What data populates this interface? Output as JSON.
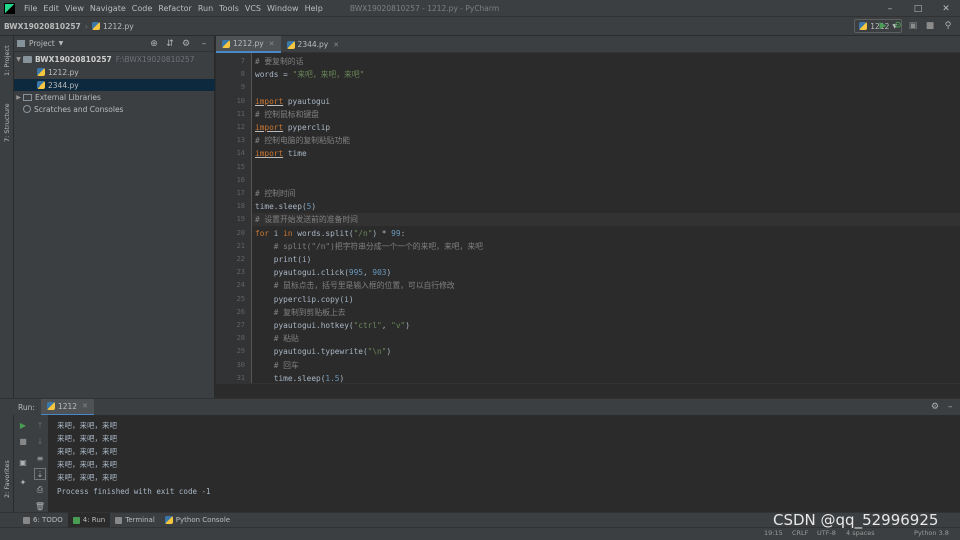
{
  "menu": {
    "items": [
      "File",
      "Edit",
      "View",
      "Navigate",
      "Code",
      "Refactor",
      "Run",
      "Tools",
      "VCS",
      "Window",
      "Help"
    ],
    "window_title": "BWX19020810257 - 1212.py - PyCharm"
  },
  "navbar": {
    "project": "BWX19020810257",
    "file": "1212.py",
    "run_config": "1212"
  },
  "project_panel": {
    "title": "Project",
    "root_name": "BWX19020810257",
    "root_path": "F:\\BWX19020810257",
    "files": [
      "1212.py",
      "2344.py"
    ],
    "external_libraries": "External Libraries",
    "scratches": "Scratches and Consoles"
  },
  "left_stripe": {
    "project_label": "1: Project",
    "structure_label": "7: Structure",
    "favorites_label": "2: Favorites"
  },
  "editor": {
    "tabs": [
      "1212.py",
      "2344.py"
    ],
    "line_numbers": [
      "7",
      "8",
      "9",
      "10",
      "11",
      "12",
      "13",
      "14",
      "15",
      "16",
      "17",
      "18",
      "19",
      "20",
      "21",
      "22",
      "23",
      "24",
      "25",
      "26",
      "27",
      "28",
      "29",
      "30",
      "31"
    ],
    "lines": [
      {
        "parts": [
          {
            "t": "# 要复制的话",
            "c": "cm"
          }
        ]
      },
      {
        "parts": [
          {
            "t": "words = ",
            "c": ""
          },
          {
            "t": "\"来吧，来吧，来吧\"",
            "c": "str"
          }
        ]
      },
      {
        "parts": []
      },
      {
        "parts": [
          {
            "t": "import",
            "c": "kw und"
          },
          {
            "t": " pyautogui",
            "c": ""
          }
        ]
      },
      {
        "parts": [
          {
            "t": "# 控制鼠标和键盘",
            "c": "cm"
          }
        ]
      },
      {
        "parts": [
          {
            "t": "import",
            "c": "kw und"
          },
          {
            "t": " pyperclip",
            "c": ""
          }
        ]
      },
      {
        "parts": [
          {
            "t": "# 控制电脑的复制粘贴功能",
            "c": "cm"
          }
        ]
      },
      {
        "parts": [
          {
            "t": "import",
            "c": "kw und"
          },
          {
            "t": " time",
            "c": ""
          }
        ]
      },
      {
        "parts": []
      },
      {
        "parts": []
      },
      {
        "parts": [
          {
            "t": "# 控制时间",
            "c": "cm"
          }
        ]
      },
      {
        "parts": [
          {
            "t": "time.sleep(",
            "c": ""
          },
          {
            "t": "5",
            "c": "num"
          },
          {
            "t": ")",
            "c": ""
          }
        ]
      },
      {
        "parts": [
          {
            "t": "# 设置开始发送前的准备时间",
            "c": "cm"
          }
        ]
      },
      {
        "parts": [
          {
            "t": "for",
            "c": "kw"
          },
          {
            "t": " i ",
            "c": ""
          },
          {
            "t": "in",
            "c": "kw"
          },
          {
            "t": " words.split(",
            "c": ""
          },
          {
            "t": "\"/n\"",
            "c": "str"
          },
          {
            "t": ") * ",
            "c": ""
          },
          {
            "t": "99",
            "c": "num"
          },
          {
            "t": ":",
            "c": ""
          }
        ]
      },
      {
        "parts": [
          {
            "t": "    # split(\"/n\")把字符串分成一个一个的来吧，来吧，来吧",
            "c": "cm"
          }
        ]
      },
      {
        "parts": [
          {
            "t": "    print",
            "c": "fn"
          },
          {
            "t": "(i)",
            "c": ""
          }
        ]
      },
      {
        "parts": [
          {
            "t": "    pyautogui.click(",
            "c": ""
          },
          {
            "t": "995",
            "c": "num"
          },
          {
            "t": ", ",
            "c": ""
          },
          {
            "t": "903",
            "c": "num"
          },
          {
            "t": ")",
            "c": ""
          }
        ]
      },
      {
        "parts": [
          {
            "t": "    # 鼠标点击，括号里是输入框的位置，可以自行修改",
            "c": "cm"
          }
        ]
      },
      {
        "parts": [
          {
            "t": "    pyperclip.copy(i)",
            "c": ""
          }
        ]
      },
      {
        "parts": [
          {
            "t": "    # 复制到剪贴板上去",
            "c": "cm"
          }
        ]
      },
      {
        "parts": [
          {
            "t": "    pyautogui.hotkey(",
            "c": ""
          },
          {
            "t": "\"ctrl\"",
            "c": "str"
          },
          {
            "t": ", ",
            "c": ""
          },
          {
            "t": "\"v\"",
            "c": "str"
          },
          {
            "t": ")",
            "c": ""
          }
        ]
      },
      {
        "parts": [
          {
            "t": "    # 粘贴",
            "c": "cm"
          }
        ]
      },
      {
        "parts": [
          {
            "t": "    pyautogui.typewrite(",
            "c": ""
          },
          {
            "t": "\"\\n\"",
            "c": "str"
          },
          {
            "t": ")",
            "c": ""
          }
        ]
      },
      {
        "parts": [
          {
            "t": "    # 回车",
            "c": "cm"
          }
        ]
      },
      {
        "parts": [
          {
            "t": "    time.sleep(",
            "c": ""
          },
          {
            "t": "1.5",
            "c": "num"
          },
          {
            "t": ")",
            "c": ""
          }
        ]
      }
    ],
    "current_line_index": 12
  },
  "run": {
    "label": "Run:",
    "tab": "1212",
    "console_lines": [
      "来吧，来吧，来吧",
      "来吧，来吧，来吧",
      "来吧，来吧，来吧",
      "来吧，来吧，来吧",
      "来吧，来吧，来吧"
    ],
    "finish_message": "Process finished with exit code -1"
  },
  "tool_tabs": [
    "6: TODO",
    "4: Run",
    "Terminal",
    "Python Console"
  ],
  "status": {
    "position": "19:15",
    "line_sep": "CRLF",
    "encoding": "UTF-8",
    "indent": "4 spaces",
    "interpreter": "Python 3.8"
  },
  "watermark": "CSDN @qq_52996925",
  "colors": {
    "keyword": "#cc7832",
    "comment": "#808080",
    "string": "#6a8759",
    "number": "#6897bb",
    "run_green": "#499c54",
    "selection": "#0d293e"
  }
}
